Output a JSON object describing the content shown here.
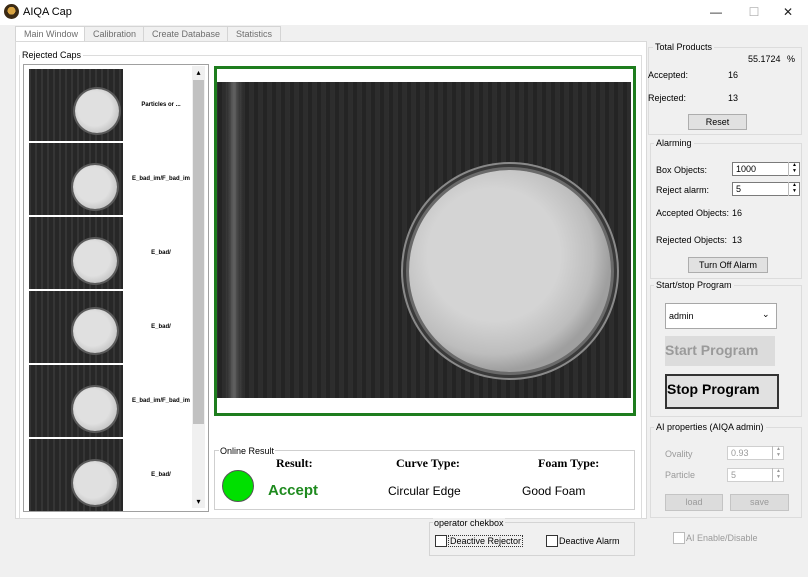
{
  "window": {
    "title": "AIQA Cap",
    "min": "—",
    "max": "☐",
    "close": "✕"
  },
  "tabs": [
    {
      "label": "Main Window"
    },
    {
      "label": "Calibration"
    },
    {
      "label": "Create Database"
    },
    {
      "label": "Statistics"
    }
  ],
  "rejected": {
    "title": "Rejected Caps",
    "items": [
      {
        "label": "Particles or ..."
      },
      {
        "label": "E_bad_im/F_bad_im"
      },
      {
        "label": "E_bad/"
      },
      {
        "label": "E_bad/"
      },
      {
        "label": "E_bad_im/F_bad_im"
      },
      {
        "label": "E_bad/"
      }
    ]
  },
  "online": {
    "title": "Online Result",
    "result_head": "Result:",
    "curve_head": "Curve Type:",
    "foam_head": "Foam Type:",
    "result": "Accept",
    "curve": "Circular Edge",
    "foam": "Good Foam",
    "light_color": "#00e000"
  },
  "operator": {
    "title": "operator chekbox",
    "deactive_rejector": "Deactive Rejector",
    "deactive_alarm": "Deactive Alarm"
  },
  "total": {
    "title": "Total Products",
    "percent": "55.1724",
    "percent_unit": "%",
    "accepted_label": "Accepted:",
    "accepted": "16",
    "rejected_label": "Rejected:",
    "rejected": "13",
    "reset": "Reset"
  },
  "alarming": {
    "title": "Alarming",
    "box_label": "Box Objects:",
    "box_value": "1000",
    "reject_label": "Reject alarm:",
    "reject_value": "5",
    "accepted_label": "Accepted Objects:",
    "accepted": "16",
    "rejected_label": "Rejected Objects:",
    "rejected": "13",
    "turn_off": "Turn Off Alarm"
  },
  "program": {
    "title": "Start/stop Program",
    "user": "admin",
    "start": "Start Program",
    "stop": "Stop Program"
  },
  "ai": {
    "title": "AI properties (AIQA admin)",
    "ovality_label": "Ovality",
    "ovality": "0.93",
    "particle_label": "Particle",
    "particle": "5",
    "load": "load",
    "save": "save",
    "enable": "AI Enable/Disable"
  },
  "colors": {
    "accent_green": "#1e7d1e",
    "light_green": "#00e000"
  }
}
